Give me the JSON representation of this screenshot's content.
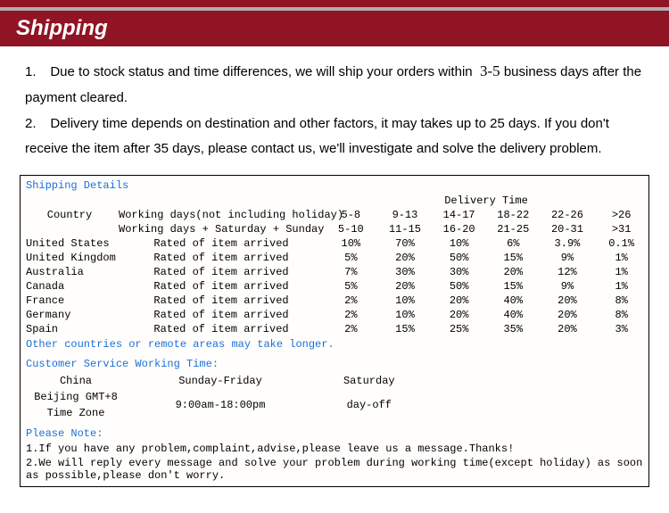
{
  "header": {
    "title": "Shipping"
  },
  "intro": {
    "p1a": "1.",
    "p1b": "Due to stock status and time differences, we will ship your orders within",
    "p1days": "3-5",
    "p1c": "business days after the payment cleared.",
    "p2a": "2.",
    "p2b": "Delivery time depends on destination and other factors, it may takes up to 25 days. If you don't receive the item after 35 days, please contact us, we'll investigate and solve the delivery problem."
  },
  "details": {
    "title": "Shipping Details",
    "deliveryTimeLabel": "Delivery Time",
    "countryLabel": "Country",
    "workingRow1": "Working days(not including holiday)",
    "workingRow2": "Working days + Saturday + Sunday",
    "wdRanges": [
      "5-8",
      "9-13",
      "14-17",
      "18-22",
      "22-26",
      ">26"
    ],
    "wsRanges": [
      "5-10",
      "11-15",
      "16-20",
      "21-25",
      "20-31",
      ">31"
    ],
    "ratedLabel": "Rated of item arrived",
    "rows": [
      {
        "country": "United States",
        "vals": [
          "10%",
          "70%",
          "10%",
          "6%",
          "3.9%",
          "0.1%"
        ]
      },
      {
        "country": "United Kingdom",
        "vals": [
          "5%",
          "20%",
          "50%",
          "15%",
          "9%",
          "1%"
        ]
      },
      {
        "country": "Australia",
        "vals": [
          "7%",
          "30%",
          "30%",
          "20%",
          "12%",
          "1%"
        ]
      },
      {
        "country": "Canada",
        "vals": [
          "5%",
          "20%",
          "50%",
          "15%",
          "9%",
          "1%"
        ]
      },
      {
        "country": "France",
        "vals": [
          "2%",
          "10%",
          "20%",
          "40%",
          "20%",
          "8%"
        ]
      },
      {
        "country": "Germany",
        "vals": [
          "2%",
          "10%",
          "20%",
          "40%",
          "20%",
          "8%"
        ]
      },
      {
        "country": "Spain",
        "vals": [
          "2%",
          "15%",
          "25%",
          "35%",
          "20%",
          "3%"
        ]
      }
    ],
    "otherNote": "Other countries or remote areas may take longer."
  },
  "service": {
    "title": "Customer Service Working Time:",
    "col1a": "China",
    "col1b": "Beijing GMT+8",
    "col1c": "Time Zone",
    "col2a": "Sunday-Friday",
    "col2b": "9:00am-18:00pm",
    "col3a": "Saturday",
    "col3b": "day-off"
  },
  "pleaseNote": {
    "title": "Please Note:",
    "n1": "1.If you have any problem,complaint,advise,please leave us a message.Thanks!",
    "n2": "2.We will reply every message and solve your problem during working time(except holiday) as soon as possible,please don't worry."
  }
}
